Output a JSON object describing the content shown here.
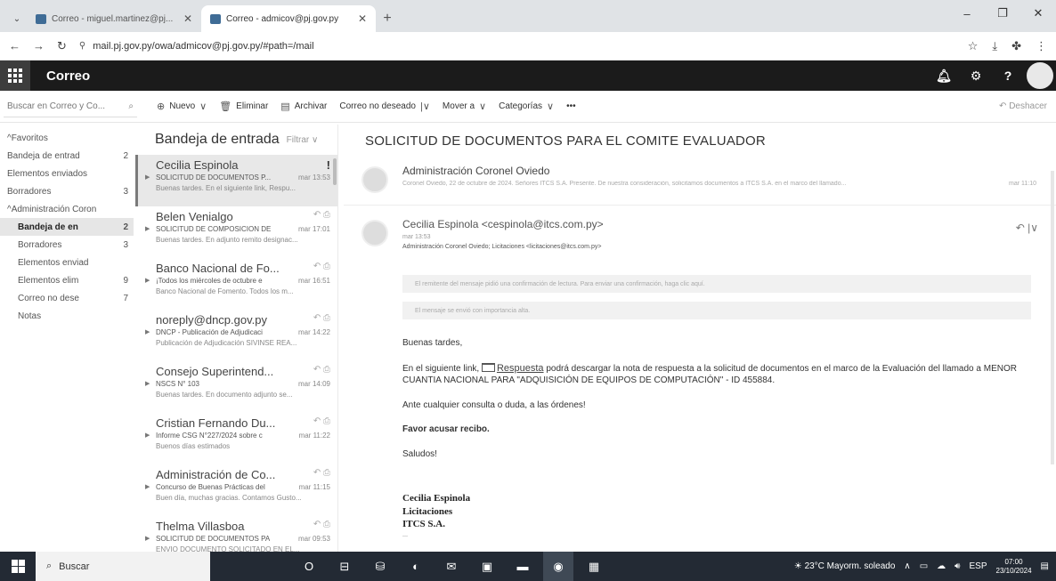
{
  "browser": {
    "tabs": [
      {
        "label": "Correo - miguel.martinez@pj...",
        "active": false
      },
      {
        "label": "Correo - admicov@pj.gov.py",
        "active": true
      }
    ],
    "url": "mail.pj.gov.py/owa/admicov@pj.gov.py/#path=/mail"
  },
  "header": {
    "app_title": "Correo"
  },
  "commands": {
    "search_placeholder": "Buscar en Correo y Co...",
    "new": "Nuevo",
    "delete": "Eliminar",
    "archive": "Archivar",
    "junk": "Correo no deseado",
    "move": "Mover a",
    "categories": "Categorías",
    "more": "•••",
    "undo": "Deshacer"
  },
  "folders": [
    {
      "name": "Favoritos",
      "count": "",
      "type": "group"
    },
    {
      "name": "Bandeja de entrad",
      "count": "2",
      "type": "item"
    },
    {
      "name": "Elementos enviados",
      "count": "",
      "type": "item"
    },
    {
      "name": "Borradores",
      "count": "3",
      "type": "item"
    },
    {
      "name": "Administración Coron",
      "count": "",
      "type": "group"
    },
    {
      "name": "Bandeja de en",
      "count": "2",
      "type": "sub-selected"
    },
    {
      "name": "Borradores",
      "count": "3",
      "type": "sub"
    },
    {
      "name": "Elementos enviad",
      "count": "",
      "type": "sub"
    },
    {
      "name": "Elementos elim",
      "count": "9",
      "type": "sub"
    },
    {
      "name": "Correo no dese",
      "count": "7",
      "type": "sub"
    },
    {
      "name": "Notas",
      "count": "",
      "type": "sub"
    }
  ],
  "message_list": {
    "title": "Bandeja de entrada",
    "filter": "Filtrar",
    "messages": [
      {
        "sender": "Cecilia Espinola",
        "subject": "SOLICITUD DE DOCUMENTOS P...",
        "date": "mar 13:53",
        "preview": "Buenas tardes. En el siguiente link, Respu...",
        "selected": true,
        "flag": "!"
      },
      {
        "sender": "Belen Venialgo",
        "subject": "SOLICITUD DE COMPOSICION DE",
        "date": "mar 17:01",
        "preview": "Buenas tardes. En adjunto remito designac...",
        "selected": false,
        "flag": ""
      },
      {
        "sender": "Banco Nacional de Fo...",
        "subject": "¡Todos los miércoles de octubre e",
        "date": "mar 16:51",
        "preview": "Banco Nacional de Fomento. Todos los m...",
        "selected": false,
        "flag": ""
      },
      {
        "sender": "noreply@dncp.gov.py",
        "subject": "DNCP - Publicación de Adjudicaci",
        "date": "mar 14:22",
        "preview": "Publicación de Adjudicación SIVINSE REA...",
        "selected": false,
        "flag": ""
      },
      {
        "sender": "Consejo Superintend...",
        "subject": "NSCS N° 103",
        "date": "mar 14:09",
        "preview": "Buenas tardes. En documento adjunto se...",
        "selected": false,
        "flag": ""
      },
      {
        "sender": "Cristian Fernando Du...",
        "subject": "Informe CSG N°227/2024 sobre c",
        "date": "mar 11:22",
        "preview": "Buenos días estimados",
        "selected": false,
        "flag": ""
      },
      {
        "sender": "Administración de Co...",
        "subject": "Concurso de Buenas Prácticas del",
        "date": "mar 11:15",
        "preview": "Buen día, muchas gracias. Contamos Gusto...",
        "selected": false,
        "flag": ""
      },
      {
        "sender": "Thelma Villasboa",
        "subject": "SOLICITUD DE DOCUMENTOS PA",
        "date": "mar 09:53",
        "preview": "ENVIO DOCUMENTO SOLICITADO EN EL...",
        "selected": false,
        "flag": ""
      }
    ]
  },
  "reading": {
    "subject": "SOLICITUD DE DOCUMENTOS PARA EL COMITE EVALUADOR",
    "collapsed": {
      "name": "Administración Coronel Oviedo",
      "preview": "Coronel Oviedo, 22 de octubre de 2024. Señores ITCS S.A. Presente. De nuestra consideración, solicitamos documentos a ITCS S.A. en el marco del llamado...",
      "date": "mar 11:10"
    },
    "from": "Cecilia Espinola <cespinola@itcs.com.py>",
    "when": "mar 13:53",
    "to": "Administración Coronel Oviedo; Licitaciones <licitaciones@itcs.com.py>",
    "notice_read_receipt": "El remitente del mensaje pidió una confirmación de lectura. Para enviar una confirmación, haga clic aquí.",
    "notice_importance": "El mensaje se envió con importancia alta.",
    "greeting": "Buenas tardes,",
    "body_pre": "En el siguiente link,",
    "link_text": "Respuesta",
    "body_post": "podrá descargar la nota de respuesta a la solicitud de documentos en el marco de la Evaluación del llamado a MENOR CUANTIA NACIONAL PARA \"ADQUISICIÓN DE EQUIPOS DE COMPUTACIÓN\" - ID 455884.",
    "question": "Ante cualquier consulta o duda, a las órdenes!",
    "ack": "Favor acusar recibo.",
    "closing": "Saludos!",
    "sig_name": "Cecilia Espinola",
    "sig_dept": "Licitaciones",
    "sig_company": "ITCS S.A.",
    "sig_more": "..."
  },
  "taskbar": {
    "search": "Buscar",
    "weather": "23°C  Mayorm. soleado",
    "lang": "ESP",
    "time": "07:00",
    "date": "23/10/2024"
  }
}
